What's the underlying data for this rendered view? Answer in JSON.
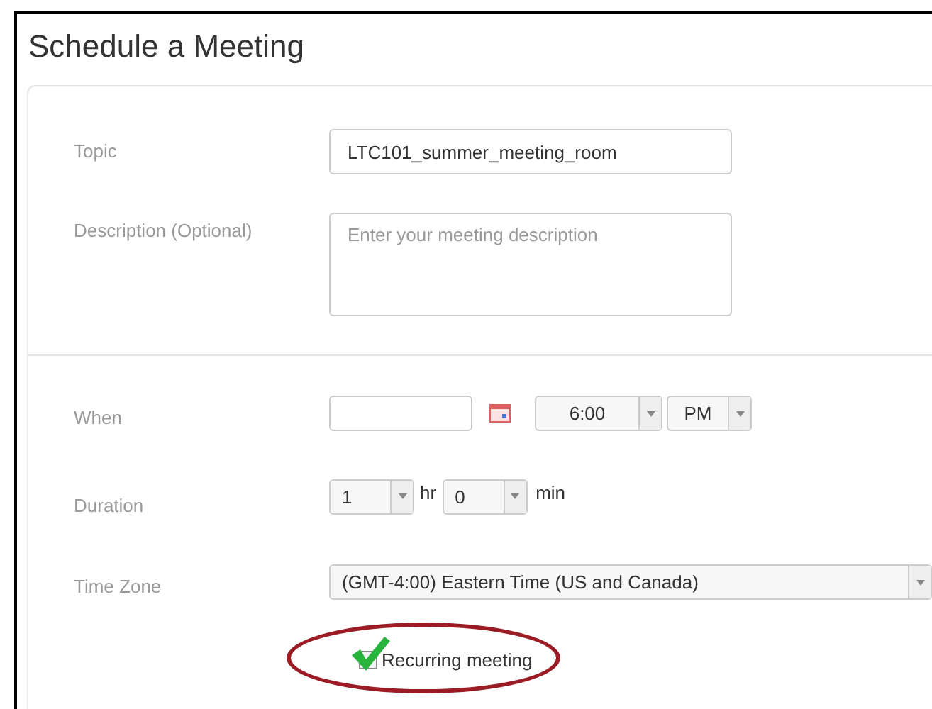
{
  "title": "Schedule a Meeting",
  "topic": {
    "label": "Topic",
    "value": "LTC101_summer_meeting_room"
  },
  "description": {
    "label": "Description (Optional)",
    "placeholder": "Enter your meeting description"
  },
  "when": {
    "label": "When",
    "time": "6:00",
    "ampm": "PM"
  },
  "duration": {
    "label": "Duration",
    "hours": "1",
    "hours_unit": "hr",
    "minutes": "0",
    "minutes_unit": "min"
  },
  "time_zone": {
    "label": "Time Zone",
    "value": "(GMT-4:00) Eastern Time (US and Canada)"
  },
  "recurring": {
    "label": "Recurring meeting",
    "checked": true,
    "highlighted": true
  }
}
